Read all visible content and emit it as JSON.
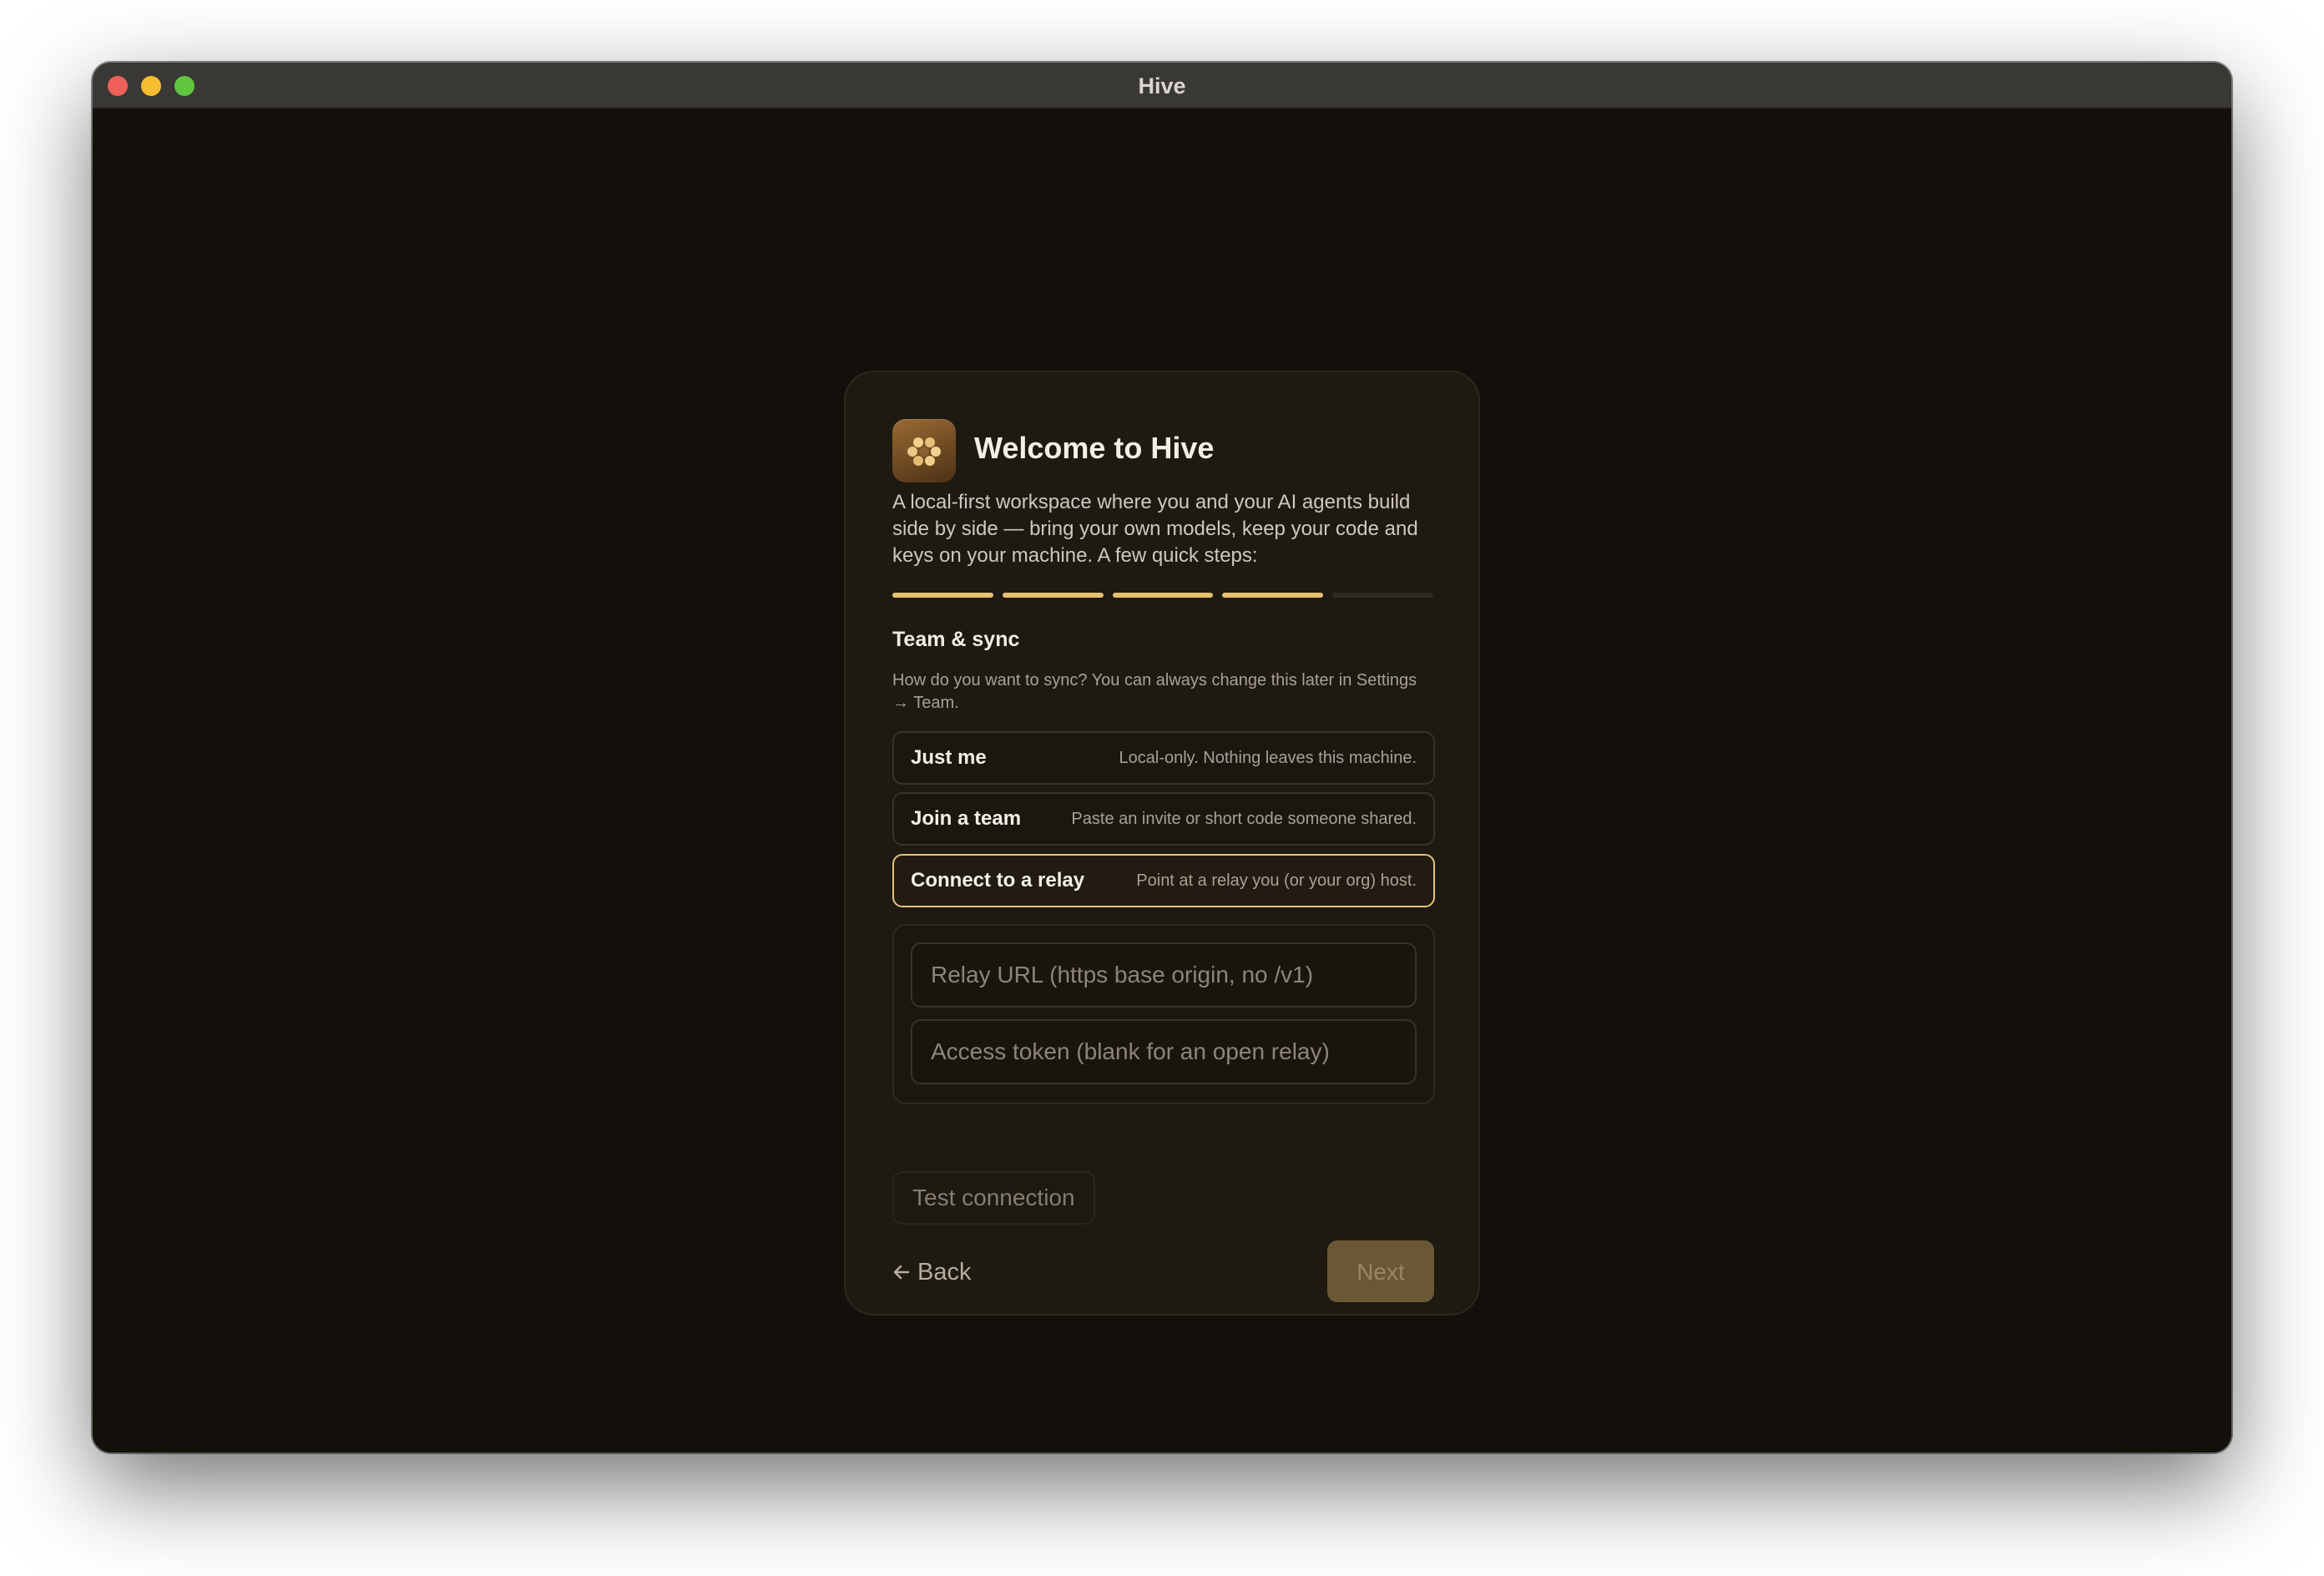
{
  "window": {
    "title": "Hive"
  },
  "onboarding": {
    "title": "Welcome to Hive",
    "intro": "A local-first workspace where you and your AI agents build side by side — bring your own models, keep your code and keys on your machine. A few quick steps:",
    "progress": {
      "total_steps": 5,
      "completed_steps": 4
    },
    "step": {
      "title": "Team & sync",
      "description": "How do you want to sync? You can always change this later in Settings → Team."
    },
    "options": [
      {
        "label": "Just me",
        "description": "Local-only. Nothing leaves this machine.",
        "selected": false
      },
      {
        "label": "Join a team",
        "description": "Paste an invite or short code someone shared.",
        "selected": false
      },
      {
        "label": "Connect to a relay",
        "description": "Point at a relay you (or your org) host.",
        "selected": true
      }
    ],
    "relay": {
      "url_value": "",
      "url_placeholder": "Relay URL (https base origin, no /v1)",
      "token_value": "",
      "token_placeholder": "Access token (blank for an open relay)"
    },
    "test_connection_label": "Test connection",
    "back_label": "Back",
    "next_label": "Next"
  },
  "icons": {
    "logo": "honeycomb-icon",
    "back": "arrow-left-icon"
  },
  "colors": {
    "accent": "#e8c070",
    "background": "#13100b",
    "card": "#1e1911"
  }
}
